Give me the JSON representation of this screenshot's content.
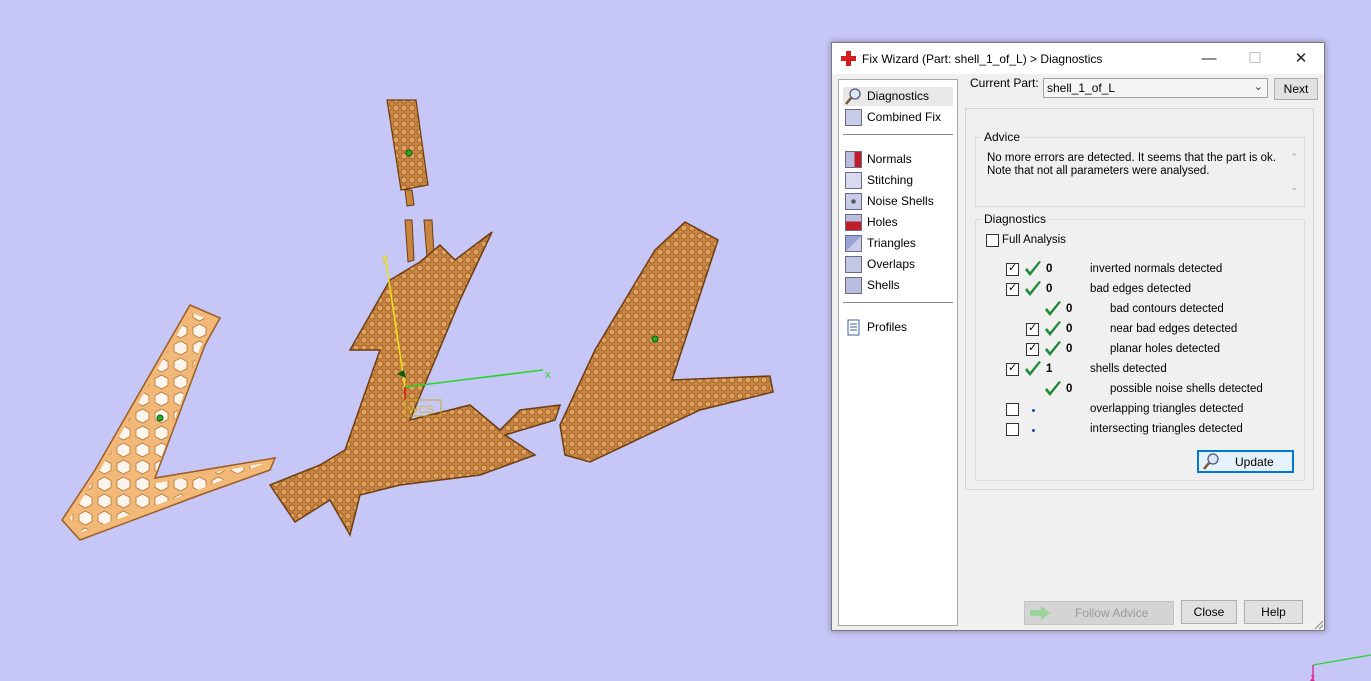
{
  "window": {
    "title": "Fix Wizard (Part: shell_1_of_L) > Diagnostics",
    "minimize": "—",
    "maximize": "☐",
    "close": "✕"
  },
  "viewport": {
    "triad_label": "WCS",
    "axis_x": "x",
    "axis_y": "y",
    "axis_z": "z"
  },
  "nav": {
    "items_top": [
      {
        "label": "Diagnostics",
        "icon": "magnifier-icon"
      },
      {
        "label": "Combined Fix",
        "icon": "cube-icon"
      }
    ],
    "items_mid": [
      {
        "label": "Normals",
        "icon": "normals-cube-icon"
      },
      {
        "label": "Stitching",
        "icon": "stitching-cube-icon"
      },
      {
        "label": "Noise Shells",
        "icon": "noise-shells-cube-icon"
      },
      {
        "label": "Holes",
        "icon": "holes-cube-icon"
      },
      {
        "label": "Triangles",
        "icon": "triangles-cube-icon"
      },
      {
        "label": "Overlaps",
        "icon": "overlaps-cube-icon"
      },
      {
        "label": "Shells",
        "icon": "shells-cube-icon"
      }
    ],
    "items_bottom": [
      {
        "label": "Profiles",
        "icon": "document-icon"
      }
    ]
  },
  "current_part": {
    "label": "Current Part:",
    "value": "shell_1_of_L",
    "next_button": "Next"
  },
  "advice": {
    "title": "Advice",
    "line1": "No more errors are detected. It seems that the part is ok.",
    "line2": "Note that not all parameters were analysed."
  },
  "diagnostics": {
    "title": "Diagnostics",
    "full_analysis_label": "Full Analysis",
    "full_analysis_checked": false,
    "rows": [
      {
        "checkbox": true,
        "checked": true,
        "status": "ok",
        "count": "0",
        "label": "inverted normals detected",
        "indent": 0
      },
      {
        "checkbox": true,
        "checked": true,
        "status": "ok",
        "count": "0",
        "label": "bad edges detected",
        "indent": 0
      },
      {
        "checkbox": false,
        "checked": false,
        "status": "ok",
        "count": "0",
        "label": "bad contours detected",
        "indent": 1
      },
      {
        "checkbox": true,
        "checked": true,
        "status": "ok",
        "count": "0",
        "label": "near bad edges detected",
        "indent": 1
      },
      {
        "checkbox": true,
        "checked": true,
        "status": "ok",
        "count": "0",
        "label": "planar holes detected",
        "indent": 1
      },
      {
        "checkbox": true,
        "checked": true,
        "status": "ok",
        "count": "1",
        "label": "shells detected",
        "indent": 0
      },
      {
        "checkbox": false,
        "checked": false,
        "status": "ok",
        "count": "0",
        "label": "possible noise shells detected",
        "indent": 1
      },
      {
        "checkbox": true,
        "checked": false,
        "status": "none",
        "count": "",
        "label": "overlapping triangles detected",
        "indent": 0
      },
      {
        "checkbox": true,
        "checked": false,
        "status": "none",
        "count": "",
        "label": "intersecting triangles detected",
        "indent": 0
      }
    ],
    "update_button": "Update"
  },
  "footer": {
    "follow_advice": "Follow Advice",
    "close": "Close",
    "help": "Help"
  },
  "colors": {
    "background": "#c6c6f7",
    "part_fill": "#d9954f",
    "part_fill_light": "#f2b877",
    "check_green": "#1f8a3a"
  }
}
